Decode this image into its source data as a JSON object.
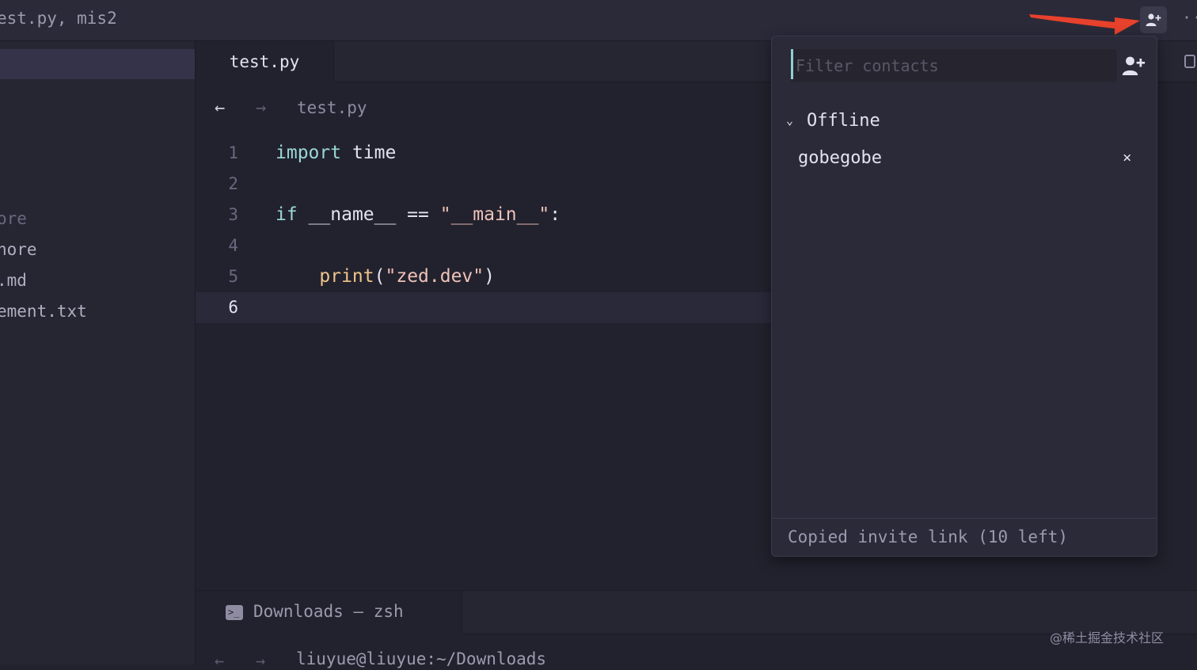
{
  "window": {
    "title": "est.py, mis2"
  },
  "titlebar": {
    "add_contact_icon": "person-plus-icon",
    "more_icon": "ellipsis-icon",
    "more_glyph": "···"
  },
  "sidebar": {
    "items": [
      {
        "label": "ore",
        "color": "#6a6880"
      },
      {
        "label": "nore",
        "color": "#b0aec0"
      },
      {
        "label": ".md",
        "color": "#b0aec0"
      },
      {
        "label": "ement.txt",
        "color": "#b0aec0"
      }
    ]
  },
  "tabs": [
    {
      "label": "test.py",
      "active": true
    }
  ],
  "breadcrumb": {
    "back_glyph": "←",
    "forward_glyph": "→",
    "file": "test.py"
  },
  "editor": {
    "lines": [
      {
        "number": "1",
        "tokens": [
          {
            "t": "import",
            "c": "kw"
          },
          {
            "t": " ",
            "c": "id"
          },
          {
            "t": "time",
            "c": "id"
          }
        ]
      },
      {
        "number": "2",
        "tokens": []
      },
      {
        "number": "3",
        "tokens": [
          {
            "t": "if",
            "c": "kw"
          },
          {
            "t": " __name__ == ",
            "c": "id"
          },
          {
            "t": "\"__main__\"",
            "c": "str"
          },
          {
            "t": ":",
            "c": "id"
          }
        ]
      },
      {
        "number": "4",
        "tokens": []
      },
      {
        "number": "5",
        "tokens": [
          {
            "t": "    ",
            "c": "id"
          },
          {
            "t": "print",
            "c": "fn"
          },
          {
            "t": "(",
            "c": "id"
          },
          {
            "t": "\"zed.dev\"",
            "c": "str"
          },
          {
            "t": ")",
            "c": "id"
          }
        ]
      },
      {
        "number": "6",
        "tokens": [],
        "active": true
      }
    ]
  },
  "terminal": {
    "tab_label": "Downloads — zsh",
    "tab_icon_glyph": ">_",
    "back_glyph": "←",
    "forward_glyph": "→",
    "prompt_text": "liuyue@liuyue:~/Downloads"
  },
  "contacts_popover": {
    "filter_placeholder": "Filter contacts",
    "filter_value": "",
    "add_icon": "person-plus-icon",
    "section_label": "Offline",
    "section_chevron": "⌄",
    "contacts": [
      {
        "name": "gobegobe",
        "remove_glyph": "×"
      }
    ],
    "footer_text": "Copied invite link (10 left)"
  },
  "annotation": {
    "arrow_color": "#e8412c"
  },
  "watermark": {
    "text": "@稀土掘金技术社区"
  },
  "colors": {
    "background": "#22222e",
    "keyword": "#9bd7d6",
    "function": "#f0c48a",
    "string": "#efc2b8",
    "caret": "#8fd0cf"
  }
}
